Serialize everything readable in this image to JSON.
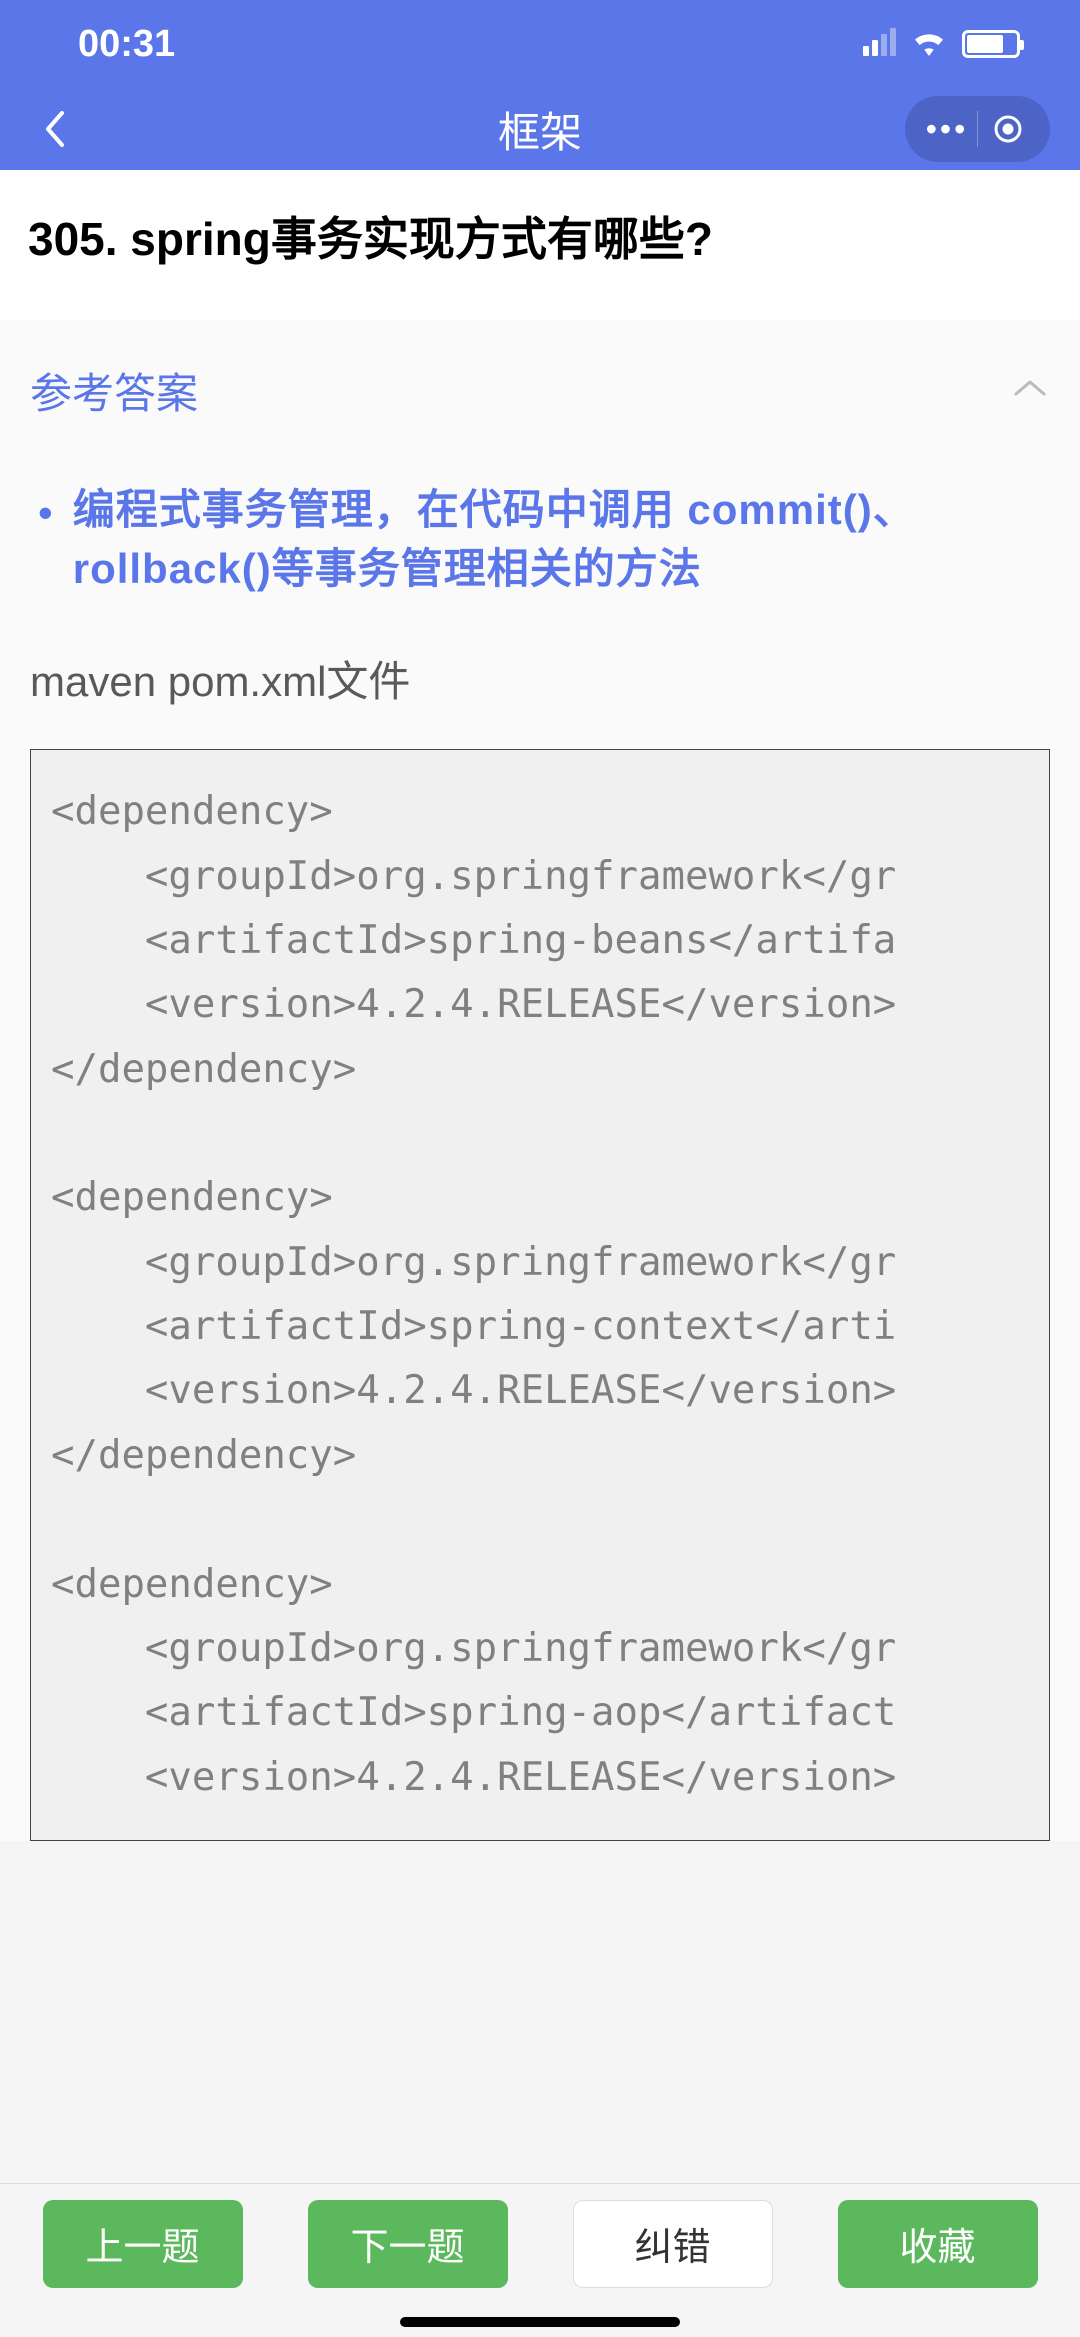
{
  "statusBar": {
    "time": "00:31"
  },
  "navBar": {
    "title": "框架"
  },
  "question": {
    "number": "305.",
    "title": "305. spring事务实现方式有哪些?"
  },
  "answer": {
    "label": "参考答案",
    "bulletPoint": "编程式事务管理，在代码中调用 commit()、rollback()等事务管理相关的方法",
    "fileLabel": "maven pom.xml文件",
    "codeContent": "<dependency>\n    <groupId>org.springframework</gr\n    <artifactId>spring-beans</artifa\n    <version>4.2.4.RELEASE</version>\n</dependency>\n\n<dependency>\n    <groupId>org.springframework</gr\n    <artifactId>spring-context</arti\n    <version>4.2.4.RELEASE</version>\n</dependency>\n\n<dependency>\n    <groupId>org.springframework</gr\n    <artifactId>spring-aop</artifact\n    <version>4.2.4.RELEASE</version>"
  },
  "bottomBar": {
    "prev": "上一题",
    "next": "下一题",
    "report": "纠错",
    "favorite": "收藏"
  }
}
